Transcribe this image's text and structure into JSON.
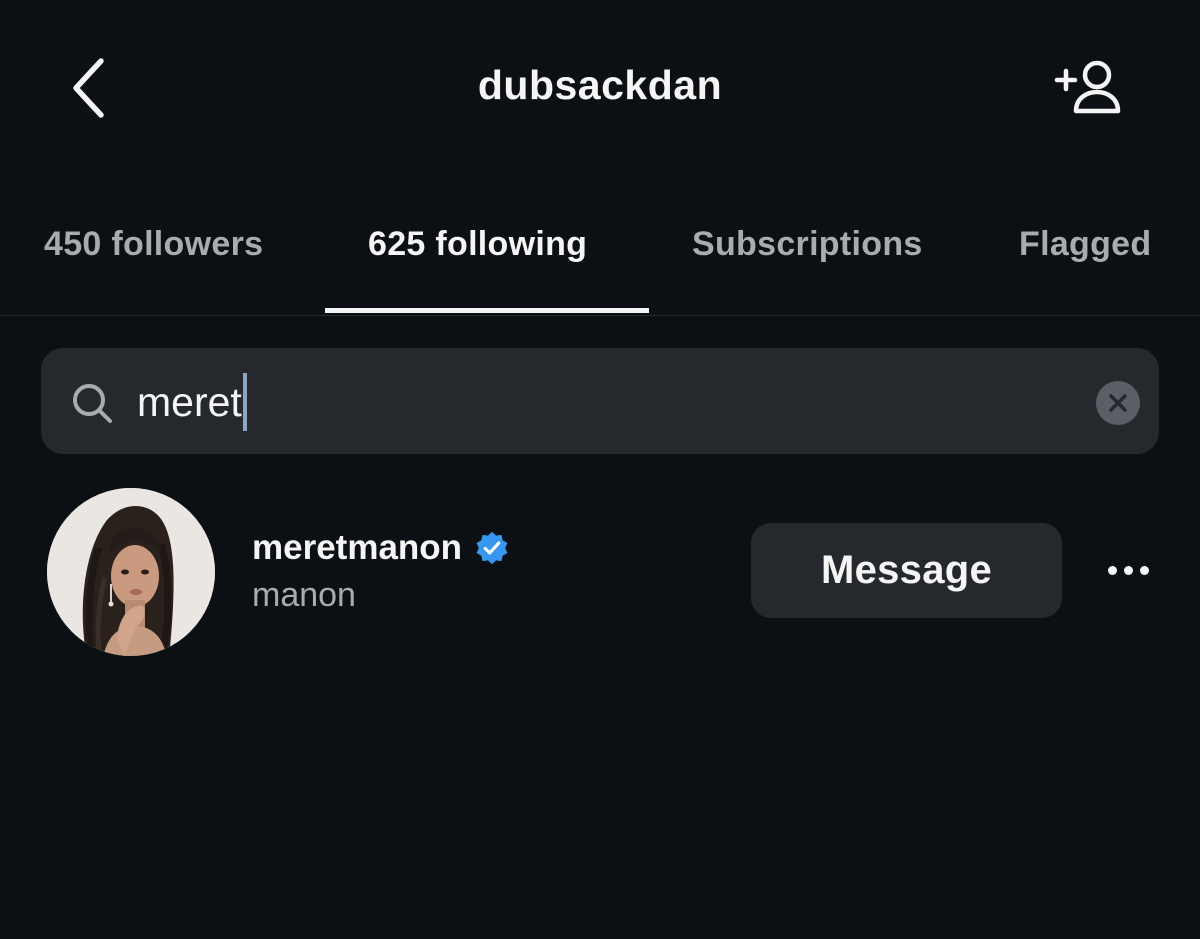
{
  "header": {
    "title": "dubsackdan",
    "back_icon": "chevron-left-icon",
    "add_user_icon": "add-person-icon"
  },
  "tabs": [
    {
      "label": "450 followers",
      "active": false
    },
    {
      "label": "625 following",
      "active": true
    },
    {
      "label": "Subscriptions",
      "active": false
    },
    {
      "label": "Flagged",
      "active": false
    }
  ],
  "search": {
    "value": "meret",
    "icon": "search-icon",
    "clear_icon": "clear-icon"
  },
  "results": [
    {
      "username": "meretmanon",
      "full_name": "manon",
      "verified": true,
      "button_label": "Message",
      "more_icon": "more-options-icon"
    }
  ],
  "colors": {
    "background": "#0c1014",
    "surface": "#25292e",
    "text_primary": "#f5f5f5",
    "text_secondary": "#a8abaf",
    "verified_badge": "#3797f0"
  }
}
